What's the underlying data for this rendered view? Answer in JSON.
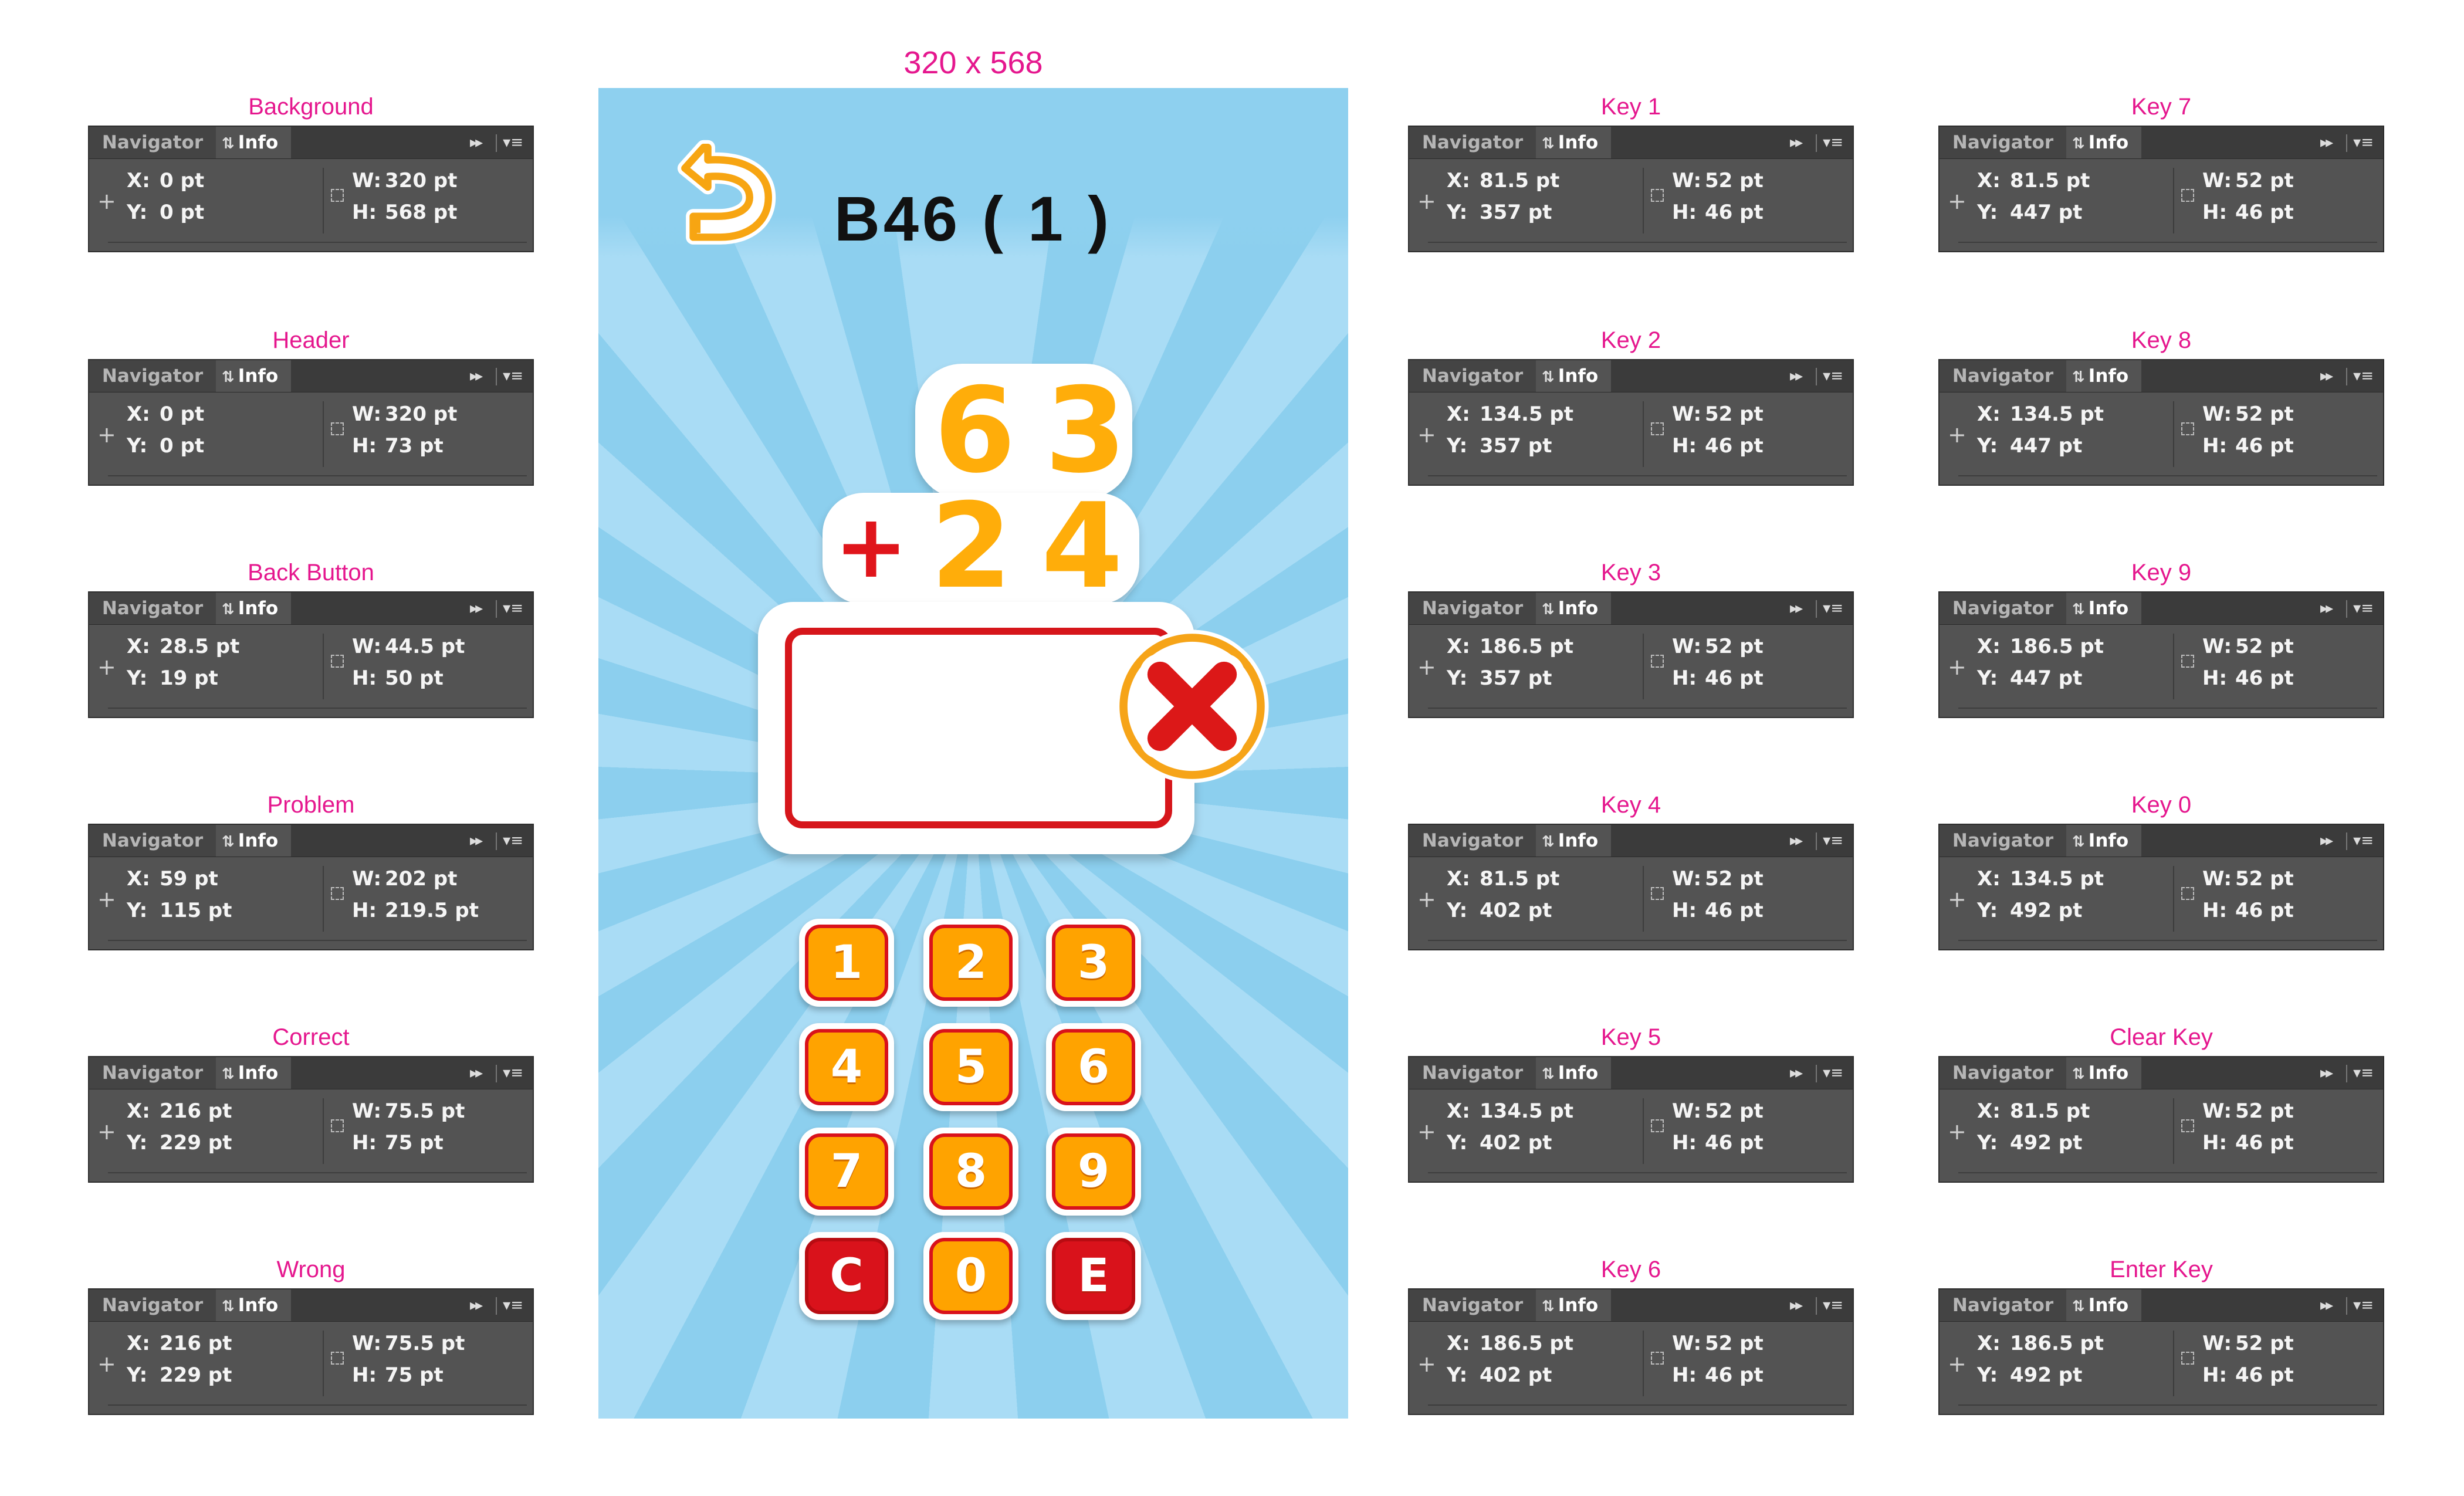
{
  "phone": {
    "size_label": "320 x 568",
    "level_label": "B46 ( 1 )",
    "top_number": "6 3",
    "operator": "+",
    "bottom_number": "2 4",
    "answer_value": ""
  },
  "keypad": [
    "1",
    "2",
    "3",
    "4",
    "5",
    "6",
    "7",
    "8",
    "9",
    "C",
    "0",
    "E"
  ],
  "panel_ui": {
    "navigator_tab": "Navigator",
    "info_tab": "Info",
    "x_label": "X:",
    "y_label": "Y:",
    "w_label": "W:",
    "h_label": "H:"
  },
  "panels": [
    {
      "title": "Background",
      "x": "0 pt",
      "y": "0 pt",
      "w": "320 pt",
      "h": "568 pt"
    },
    {
      "title": "Header",
      "x": "0 pt",
      "y": "0 pt",
      "w": "320 pt",
      "h": "73 pt"
    },
    {
      "title": "Back Button",
      "x": "28.5 pt",
      "y": "19 pt",
      "w": "44.5 pt",
      "h": "50 pt"
    },
    {
      "title": "Problem",
      "x": "59 pt",
      "y": "115 pt",
      "w": "202 pt",
      "h": "219.5 pt"
    },
    {
      "title": "Correct",
      "x": "216 pt",
      "y": "229 pt",
      "w": "75.5 pt",
      "h": "75 pt"
    },
    {
      "title": "Wrong",
      "x": "216 pt",
      "y": "229 pt",
      "w": "75.5 pt",
      "h": "75 pt"
    },
    {
      "title": "Key 1",
      "x": "81.5 pt",
      "y": "357 pt",
      "w": "52 pt",
      "h": "46 pt"
    },
    {
      "title": "Key 2",
      "x": "134.5 pt",
      "y": "357 pt",
      "w": "52 pt",
      "h": "46 pt"
    },
    {
      "title": "Key 3",
      "x": "186.5 pt",
      "y": "357 pt",
      "w": "52 pt",
      "h": "46 pt"
    },
    {
      "title": "Key 4",
      "x": "81.5 pt",
      "y": "402 pt",
      "w": "52 pt",
      "h": "46 pt"
    },
    {
      "title": "Key 5",
      "x": "134.5 pt",
      "y": "402 pt",
      "w": "52 pt",
      "h": "46 pt"
    },
    {
      "title": "Key 6",
      "x": "186.5 pt",
      "y": "402 pt",
      "w": "52 pt",
      "h": "46 pt"
    },
    {
      "title": "Key 7",
      "x": "81.5 pt",
      "y": "447 pt",
      "w": "52 pt",
      "h": "46 pt"
    },
    {
      "title": "Key 8",
      "x": "134.5 pt",
      "y": "447 pt",
      "w": "52 pt",
      "h": "46 pt"
    },
    {
      "title": "Key 9",
      "x": "186.5 pt",
      "y": "447 pt",
      "w": "52 pt",
      "h": "46 pt"
    },
    {
      "title": "Key 0",
      "x": "134.5 pt",
      "y": "492 pt",
      "w": "52 pt",
      "h": "46 pt"
    },
    {
      "title": "Clear Key",
      "x": "81.5 pt",
      "y": "492 pt",
      "w": "52 pt",
      "h": "46 pt"
    },
    {
      "title": "Enter Key",
      "x": "186.5 pt",
      "y": "492 pt",
      "w": "52 pt",
      "h": "46 pt"
    }
  ]
}
